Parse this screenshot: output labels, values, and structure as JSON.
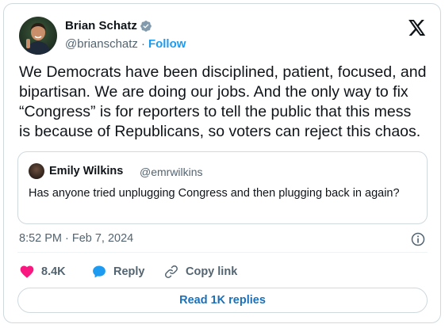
{
  "author": {
    "name": "Brian Schatz",
    "handle": "@brianschatz",
    "follow_label": "Follow"
  },
  "tweet": {
    "text": "We Democrats have been disciplined, patient, focused, and\nbipartisan. We are doing our jobs. And the only way to fix\n“Congress” is for reporters to tell the public that this mess\nis because of Republicans, so voters can reject this chaos.",
    "time": "8:52 PM",
    "date": "Feb 7, 2024",
    "dot": "·"
  },
  "quote": {
    "name": "Emily Wilkins",
    "handle": "@emrwilkins",
    "text": "Has anyone tried unplugging Congress and then plugging back in again?"
  },
  "actions": {
    "likes": "8.4K",
    "reply_label": "Reply",
    "copy_label": "Copy link"
  },
  "read_replies_label": "Read 1K replies",
  "colors": {
    "accent": "#1d9bf0",
    "like": "#f91880",
    "reply_icon": "#1d9bf0",
    "verified": "#829aab"
  },
  "icons": [
    "verified-badge-icon",
    "x-logo-icon",
    "info-icon",
    "heart-icon",
    "reply-bubble-icon",
    "link-icon"
  ]
}
